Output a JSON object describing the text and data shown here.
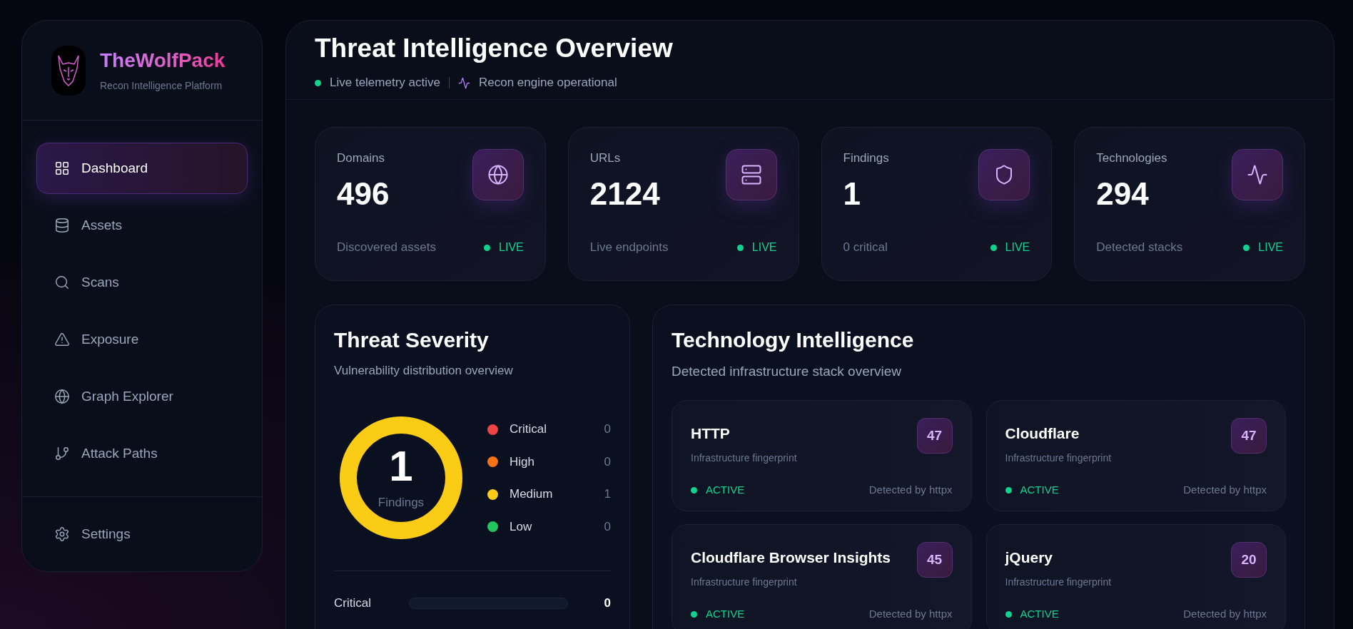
{
  "brand": {
    "name": "TheWolfPack",
    "tagline": "Recon Intelligence Platform"
  },
  "nav": [
    {
      "label": "Dashboard",
      "selected": true
    },
    {
      "label": "Assets",
      "selected": false
    },
    {
      "label": "Scans",
      "selected": false
    },
    {
      "label": "Exposure",
      "selected": false
    },
    {
      "label": "Graph Explorer",
      "selected": false
    },
    {
      "label": "Attack Paths",
      "selected": false
    }
  ],
  "nav_footer": [
    {
      "label": "Settings",
      "selected": false
    }
  ],
  "header": {
    "title": "Threat Intelligence Overview",
    "status": [
      {
        "label": "Live telemetry active",
        "kind": "dot"
      },
      {
        "label": "Recon engine operational",
        "kind": "pulse"
      }
    ]
  },
  "stats": [
    {
      "label": "Domains",
      "value": "496",
      "caption": "Discovered assets",
      "badge": "LIVE"
    },
    {
      "label": "URLs",
      "value": "2124",
      "caption": "Live endpoints",
      "badge": "LIVE"
    },
    {
      "label": "Findings",
      "value": "1",
      "caption": "0 critical",
      "badge": "LIVE"
    },
    {
      "label": "Technologies",
      "value": "294",
      "caption": "Detected stacks",
      "badge": "LIVE"
    }
  ],
  "severity": {
    "title": "Threat Severity",
    "subtitle": "Vulnerability distribution overview",
    "total": "1",
    "total_label": "Findings",
    "legend": [
      {
        "label": "Critical",
        "count": "0",
        "color": "#ef4444"
      },
      {
        "label": "High",
        "count": "0",
        "color": "#f97316"
      },
      {
        "label": "Medium",
        "count": "1",
        "color": "#facc15"
      },
      {
        "label": "Low",
        "count": "0",
        "color": "#22c55e"
      }
    ],
    "bars": [
      {
        "label": "Critical",
        "count": "0",
        "level": 0
      }
    ]
  },
  "technology": {
    "title": "Technology Intelligence",
    "subtitle": "Detected infrastructure stack overview",
    "items": [
      {
        "name": "HTTP",
        "description": "Infrastructure fingerprint",
        "count": "47",
        "status": "ACTIVE",
        "source": "Detected by httpx"
      },
      {
        "name": "Cloudflare",
        "description": "Infrastructure fingerprint",
        "count": "47",
        "status": "ACTIVE",
        "source": "Detected by httpx"
      },
      {
        "name": "Cloudflare Browser Insights",
        "description": "Infrastructure fingerprint",
        "count": "45",
        "status": "ACTIVE",
        "source": "Detected by httpx"
      },
      {
        "name": "jQuery",
        "description": "Infrastructure fingerprint",
        "count": "20",
        "status": "ACTIVE",
        "source": "Detected by httpx"
      }
    ]
  }
}
